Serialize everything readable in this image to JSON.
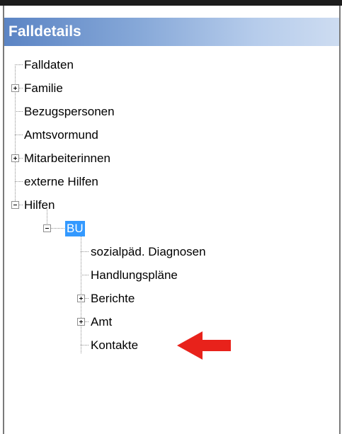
{
  "panel": {
    "title": "Falldetails"
  },
  "tree": {
    "falldaten": "Falldaten",
    "familie": "Familie",
    "bezugspersonen": "Bezugspersonen",
    "amtsvormund": "Amtsvormund",
    "mitarbeiterinnen": "Mitarbeiterinnen",
    "externe_hilfen": "externe Hilfen",
    "hilfen": "Hilfen",
    "bu": "BU",
    "diagnosen": "sozialpäd. Diagnosen",
    "handlungsplaene": "Handlungspläne",
    "berichte": "Berichte",
    "amt": "Amt",
    "kontakte": "Kontakte"
  },
  "colors": {
    "selection": "#3399ff",
    "arrow": "#e8221b",
    "header_gradient_start": "#5b84c4"
  },
  "icons": [
    "plus-expander-icon",
    "minus-expander-icon",
    "red-arrow-icon"
  ]
}
